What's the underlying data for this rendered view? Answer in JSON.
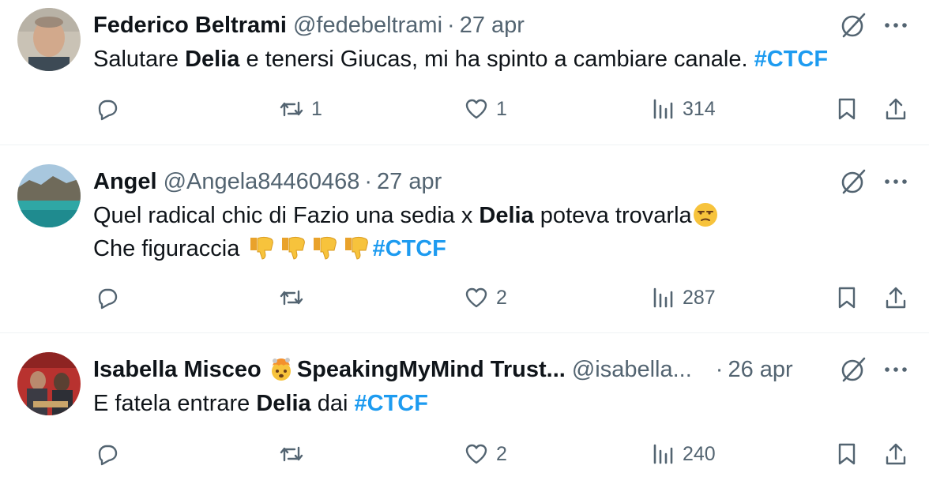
{
  "tweets": [
    {
      "name": "Federico Beltrami",
      "handle": "@fedebeltrami",
      "separator": "·",
      "date": "27 apr",
      "text_parts": [
        "Salutare ",
        "Delia",
        " e tenersi Giucas, mi ha spinto a cambiare canale. ",
        "#CTCF"
      ],
      "replies": "",
      "retweets": "1",
      "likes": "1",
      "views": "314"
    },
    {
      "name": "Angel",
      "handle": "@Angela84460468",
      "separator": "·",
      "date": "27 apr",
      "text_line1_parts": [
        "Quel radical chic di Fazio una sedia x ",
        "Delia",
        " poteva trovarla"
      ],
      "text_line2_parts": [
        "Che figuraccia ",
        "#CTCF"
      ],
      "replies": "",
      "retweets": "",
      "likes": "2",
      "views": "287"
    },
    {
      "name_part1": "Isabella Misceo ",
      "name_part2": "SpeakingMyMind Trust...",
      "handle": "@isabella...",
      "separator": "·",
      "date": "26 apr",
      "text_parts": [
        "E fatela entrare ",
        "Delia",
        " dai ",
        "#CTCF"
      ],
      "replies": "",
      "retweets": "",
      "likes": "2",
      "views": "240"
    }
  ],
  "icons": {
    "reply": "reply-icon",
    "retweet": "retweet-icon",
    "like": "heart-icon",
    "views": "views-icon",
    "bookmark": "bookmark-icon",
    "share": "share-icon",
    "grok": "grok-icon",
    "more": "more-icon"
  },
  "colors": {
    "hashtag": "#1d9bf0",
    "secondary_text": "#536471",
    "divider": "#eff3f4"
  }
}
